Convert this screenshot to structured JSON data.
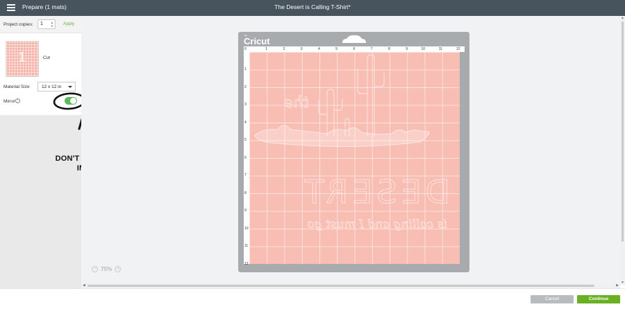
{
  "topbar": {
    "menu_icon": "hamburger-menu-icon",
    "prepare_title": "Prepare (1 mats)",
    "project_title": "The Desert is Calling T-Shirt*"
  },
  "sidebar": {
    "project_copies_label": "Project copies:",
    "project_copies_value": "1",
    "apply_label": "Apply",
    "mat_thumbnail_number": "1",
    "cut_label": "Cut",
    "material_size_label": "Material Size",
    "material_size_value": "12 x 12 in",
    "mirror_label": "Mirror",
    "mirror_on": true,
    "toggle_color": "#5cb85c"
  },
  "annotation": {
    "line1": "DON'T FORGET TO MIRROR THE",
    "line2": "IMAGE FOR IRON-ON"
  },
  "canvas": {
    "zoom_out_label": "−",
    "zoom_value": "75%",
    "zoom_in_label": "+"
  },
  "mat": {
    "logo_small": "by",
    "logo": "Cricut",
    "top_ruler": [
      "0",
      "1",
      "2",
      "3",
      "4",
      "5",
      "6",
      "7",
      "8",
      "9",
      "10",
      "11",
      "12"
    ],
    "left_ruler": [
      "1",
      "2",
      "3",
      "4",
      "5",
      "6",
      "7",
      "8",
      "9",
      "10",
      "11",
      "12"
    ],
    "mat_color": "#f8bdb3"
  },
  "design": {
    "word_the": "the",
    "word_desert": "DESERT",
    "tagline": "is calling and I must go"
  },
  "footer": {
    "cancel_label": "Cancel",
    "continue_label": "Continue",
    "continue_color": "#6ab023"
  }
}
